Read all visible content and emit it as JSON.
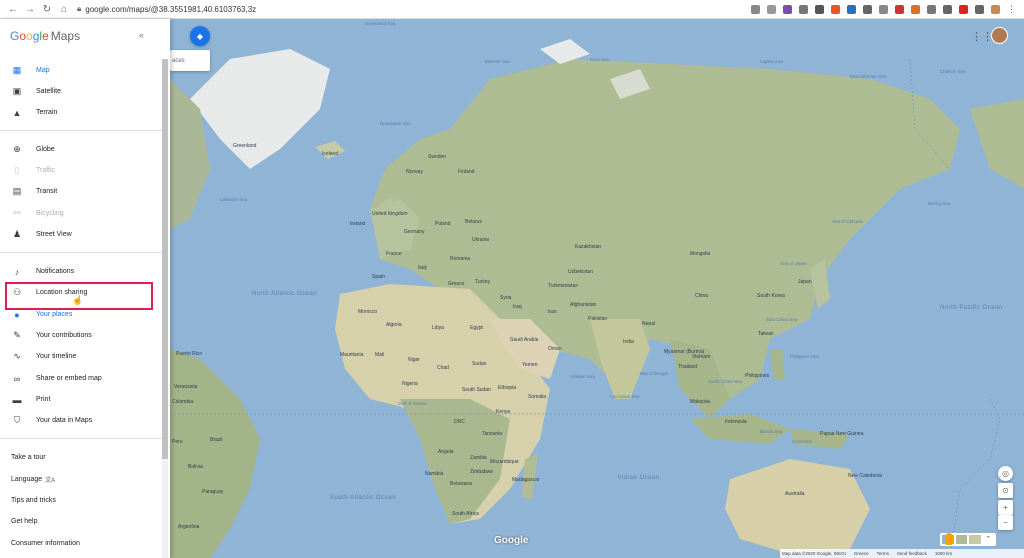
{
  "browser": {
    "url": "google.com/maps/@38.3551981,40.6103763,3z"
  },
  "sidebar": {
    "logo_g": "G",
    "logo_o1": "o",
    "logo_o2": "o",
    "logo_g2": "g",
    "logo_l": "l",
    "logo_e": "e",
    "logo_maps": "Maps",
    "section1": [
      {
        "label": "Map",
        "icon": "map-icon"
      },
      {
        "label": "Satellite",
        "icon": "satellite-icon"
      },
      {
        "label": "Terrain",
        "icon": "terrain-icon"
      }
    ],
    "section2": [
      {
        "label": "Globe",
        "icon": "globe-icon"
      },
      {
        "label": "Traffic",
        "icon": "traffic-icon"
      },
      {
        "label": "Transit",
        "icon": "transit-icon"
      },
      {
        "label": "Bicycling",
        "icon": "bicycle-icon"
      },
      {
        "label": "Street View",
        "icon": "pegman-icon"
      }
    ],
    "section3": [
      {
        "label": "Notifications",
        "icon": "bell-icon"
      },
      {
        "label": "Location sharing",
        "icon": "location-sharing-icon"
      },
      {
        "label": "Your places",
        "icon": "pin-icon"
      },
      {
        "label": "Your contributions",
        "icon": "contributions-icon"
      },
      {
        "label": "Your timeline",
        "icon": "timeline-icon"
      },
      {
        "label": "Share or embed map",
        "icon": "link-icon"
      },
      {
        "label": "Print",
        "icon": "print-icon"
      },
      {
        "label": "Your data in Maps",
        "icon": "shield-icon"
      }
    ],
    "section4": [
      {
        "label": "Take a tour"
      },
      {
        "label": "Language"
      },
      {
        "label": "Tips and tricks"
      },
      {
        "label": "Get help"
      },
      {
        "label": "Consumer information"
      }
    ],
    "lang_icon": "文A"
  },
  "map": {
    "search_fragment": "aces",
    "labels": {
      "greenland_sea": "Greenland Sea",
      "barents_sea": "Barents Sea",
      "kara_sea": "Kara Sea",
      "laptev_sea": "Laptev Sea",
      "east_siberian_sea": "East Siberian Sea",
      "chukchi_sea": "Chukchi Sea",
      "norwegian_sea": "Norwegian Sea",
      "greenland": "Greenland",
      "iceland": "Iceland",
      "labrador_sea": "Labrador Sea",
      "sweden": "Sweden",
      "finland": "Finland",
      "norway": "Norway",
      "uk": "United Kingdom",
      "ireland": "Ireland",
      "poland": "Poland",
      "germany": "Germany",
      "belarus": "Belarus",
      "ukraine": "Ukraine",
      "france": "France",
      "romania": "Romania",
      "italy": "Italy",
      "spain": "Spain",
      "greece": "Greece",
      "turkey": "Turkey",
      "kazakhstan": "Kazakhstan",
      "mongolia": "Mongolia",
      "uzbekistan": "Uzbekistan",
      "turkmenistan": "Turkmenistan",
      "syria": "Syria",
      "iraq": "Iraq",
      "iran": "Iran",
      "afghanistan": "Afghanistan",
      "pakistan": "Pakistan",
      "china": "China",
      "south_korea": "South Korea",
      "japan": "Japan",
      "sea_of_japan": "Sea of Japan",
      "sea_of_okhotsk": "Sea of Okhotsk",
      "bering_sea": "Bering Sea",
      "east_china_sea": "East China Sea",
      "taiwan": "Taiwan",
      "philippine_sea": "Philippine Sea",
      "india": "India",
      "nepal": "Nepal",
      "myanmar": "Myanmar (Burma)",
      "thailand": "Thailand",
      "vietnam": "Vietnam",
      "philippines": "Philippines",
      "malaysia": "Malaysia",
      "indonesia": "Indonesia",
      "papua_new_guinea": "Papua New Guinea",
      "arabian_sea": "Arabian Sea",
      "bay_of_bengal": "Bay of Bengal",
      "south_china_sea": "South China Sea",
      "laccadive_sea": "Laccadive Sea",
      "java_sea": "Java Sea",
      "banda_sea": "Banda Sea",
      "coral_sea": "Coral Sea",
      "north_atlantic": "North Atlantic Ocean",
      "north_pacific": "North Pacific Ocean",
      "south_atlantic": "South Atlantic Ocean",
      "indian_ocean": "Indian Ocean",
      "morocco": "Morocco",
      "algeria": "Algeria",
      "libya": "Libya",
      "egypt": "Egypt",
      "saudi_arabia": "Saudi Arabia",
      "oman": "Oman",
      "yemen": "Yemen",
      "mauritania": "Mauritania",
      "mali": "Mali",
      "niger": "Niger",
      "chad": "Chad",
      "sudan": "Sudan",
      "south_sudan": "South Sudan",
      "ethiopia": "Ethiopia",
      "somalia": "Somalia",
      "kenya": "Kenya",
      "nigeria": "Nigeria",
      "drc": "DRC",
      "tanzania": "Tanzania",
      "angola": "Angola",
      "zambia": "Zambia",
      "namibia": "Namibia",
      "botswana": "Botswana",
      "mozambique": "Mozambique",
      "madagascar": "Madagascar",
      "south_africa": "South Africa",
      "zimbabwe": "Zimbabwe",
      "gulf_of_guinea": "Gulf of Guinea",
      "venezuela": "Venezuela",
      "colombia": "Colombia",
      "peru": "Peru",
      "brazil": "Brazil",
      "bolivia": "Bolivia",
      "paraguay": "Paraguay",
      "argentina": "Argentina",
      "puerto_rico": "Puerto Rico",
      "australia": "Australia",
      "new_caledonia": "New Caledonia"
    },
    "footer": {
      "data": "Map data ©2020 Google, INEGI",
      "greece": "Greece",
      "terms": "Terms",
      "feedback": "Send feedback",
      "scale": "1000 km"
    },
    "google": "Google"
  },
  "colors": {
    "ocean": "#8fb4d6",
    "land": "#c6cba6",
    "desert": "#ddd3b4",
    "forest": "#9fb08a",
    "active": "#1a73e8",
    "highlight": "#e01e4f"
  }
}
